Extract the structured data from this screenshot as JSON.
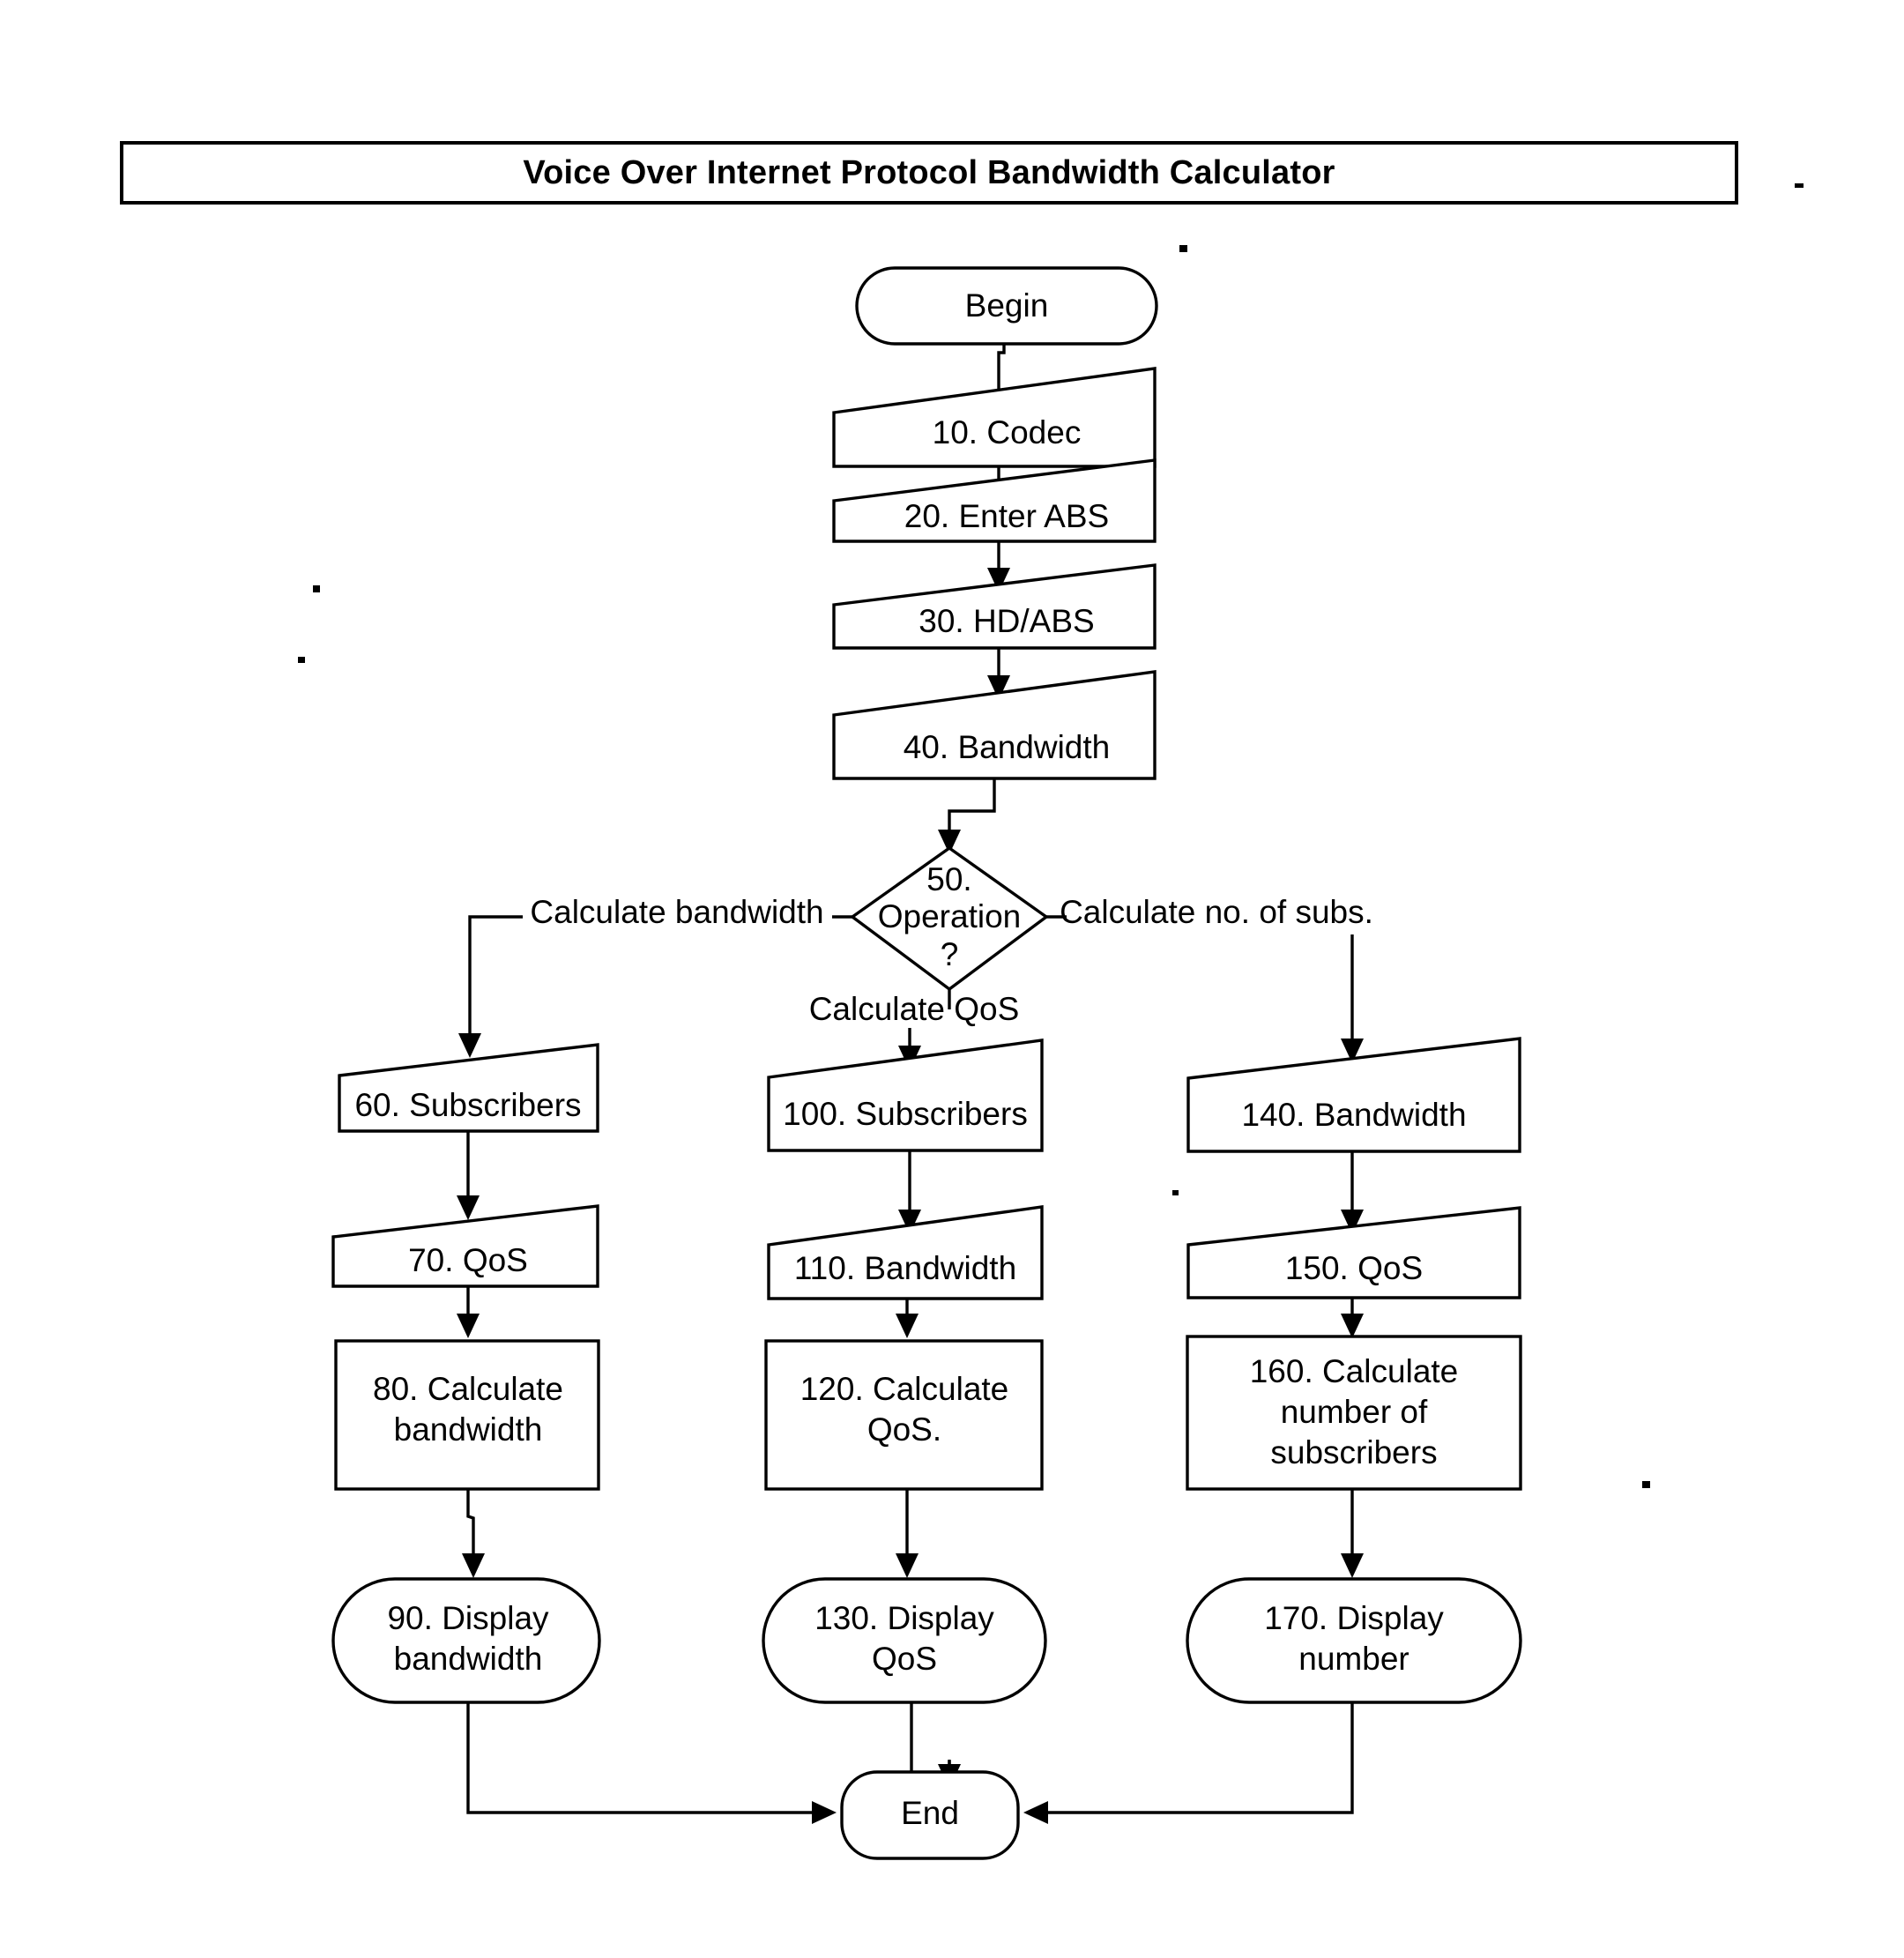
{
  "document": {
    "title": "Voice Over Internet Protocol Bandwidth Calculator"
  },
  "chart_data": {
    "type": "diagram",
    "diagram_kind": "flowchart",
    "title": "Voice Over Internet Protocol Bandwidth Calculator",
    "nodes": [
      {
        "id": "begin",
        "label": "Begin",
        "shape": "terminator"
      },
      {
        "id": "n10",
        "label": "10. Codec",
        "shape": "manual-input"
      },
      {
        "id": "n20",
        "label": "20. Enter ABS",
        "shape": "manual-input"
      },
      {
        "id": "n30",
        "label": "30. HD/ABS",
        "shape": "manual-input"
      },
      {
        "id": "n40",
        "label": "40. Bandwidth",
        "shape": "manual-input"
      },
      {
        "id": "n50",
        "label": "50. Operation ?",
        "shape": "decision"
      },
      {
        "id": "n60",
        "label": "60. Subscribers",
        "shape": "manual-input"
      },
      {
        "id": "n70",
        "label": "70. QoS",
        "shape": "manual-input"
      },
      {
        "id": "n80",
        "label": "80. Calculate bandwidth",
        "shape": "process"
      },
      {
        "id": "n90",
        "label": "90. Display bandwidth",
        "shape": "terminator"
      },
      {
        "id": "n100",
        "label": "100. Subscribers",
        "shape": "manual-input"
      },
      {
        "id": "n110",
        "label": "110. Bandwidth",
        "shape": "manual-input"
      },
      {
        "id": "n120",
        "label": "120. Calculate QoS.",
        "shape": "process"
      },
      {
        "id": "n130",
        "label": "130. Display QoS",
        "shape": "terminator"
      },
      {
        "id": "n140",
        "label": "140. Bandwidth",
        "shape": "manual-input"
      },
      {
        "id": "n150",
        "label": "150. QoS",
        "shape": "manual-input"
      },
      {
        "id": "n160",
        "label": "160. Calculate number of subscribers",
        "shape": "process"
      },
      {
        "id": "n170",
        "label": "170. Display number",
        "shape": "terminator"
      },
      {
        "id": "end",
        "label": "End",
        "shape": "terminator"
      }
    ],
    "edge_labels": [
      {
        "from": "n50",
        "to": "n60",
        "label": "Calculate bandwidth"
      },
      {
        "from": "n50",
        "to": "n100",
        "label": "Calculate QoS"
      },
      {
        "from": "n50",
        "to": "n140",
        "label": "Calculate no. of subs."
      }
    ]
  },
  "nodes": {
    "begin": {
      "label": "Begin"
    },
    "n10": {
      "label": "10. Codec"
    },
    "n20": {
      "label": "20. Enter ABS"
    },
    "n30": {
      "label": "30. HD/ABS"
    },
    "n40": {
      "label": "40. Bandwidth"
    },
    "n50": {
      "line1": "50.",
      "line2": "Operation",
      "line3": "?"
    },
    "n60": {
      "label": "60. Subscribers"
    },
    "n70": {
      "label": "70. QoS"
    },
    "n80": {
      "line1": "80. Calculate",
      "line2": "bandwidth"
    },
    "n90": {
      "line1": "90. Display",
      "line2": "bandwidth"
    },
    "n100": {
      "label": "100. Subscribers"
    },
    "n110": {
      "label": "110. Bandwidth"
    },
    "n120": {
      "line1": "120. Calculate",
      "line2": "QoS."
    },
    "n130": {
      "line1": "130. Display",
      "line2": "QoS"
    },
    "n140": {
      "label": "140. Bandwidth"
    },
    "n150": {
      "label": "150. QoS"
    },
    "n160": {
      "line1": "160. Calculate",
      "line2": "number of",
      "line3": "subscribers"
    },
    "n170": {
      "line1": "170. Display",
      "line2": "number"
    },
    "end": {
      "label": "End"
    }
  },
  "edges": {
    "left_branch": "Calculate bandwidth",
    "middle_branch": "Calculate QoS",
    "right_branch": "Calculate no. of subs."
  },
  "colors": {
    "ink": "#000000",
    "paper": "#ffffff"
  }
}
